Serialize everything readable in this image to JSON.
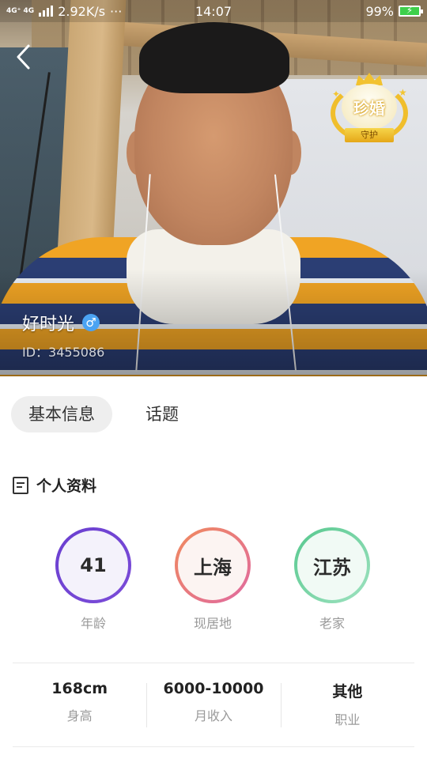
{
  "status_bar": {
    "network": "4G⁺ 4G",
    "speed": "2.92K/s",
    "more": "···",
    "time": "14:07",
    "battery_percent": "99%",
    "battery_color": "#3ecf4b"
  },
  "hero": {
    "name": "好时光",
    "gender_symbol": "♂",
    "id_text": "ID：3455086",
    "badge": {
      "title": "珍婚",
      "ribbon": "守护"
    }
  },
  "tabs": [
    {
      "label": "基本信息",
      "active": true
    },
    {
      "label": "话题",
      "active": false
    }
  ],
  "profile_section": {
    "title": "个人资料",
    "circles": [
      {
        "value": "41",
        "label": "年龄",
        "ring_from": "#6a3fd0",
        "ring_to": "#7b4cd8",
        "fill": "#f4f2fb"
      },
      {
        "value": "上海",
        "label": "现居地",
        "ring_from": "#f08a5d",
        "ring_to": "#e06aa0",
        "fill": "#fcf4f2"
      },
      {
        "value": "江苏",
        "label": "老家",
        "ring_from": "#56c88e",
        "ring_to": "#8fdcb4",
        "fill": "#f1faf5"
      }
    ],
    "stats": [
      {
        "value": "168cm",
        "label": "身高"
      },
      {
        "value": "6000-10000",
        "label": "月收入"
      },
      {
        "value": "其他",
        "label": "职业"
      }
    ]
  }
}
